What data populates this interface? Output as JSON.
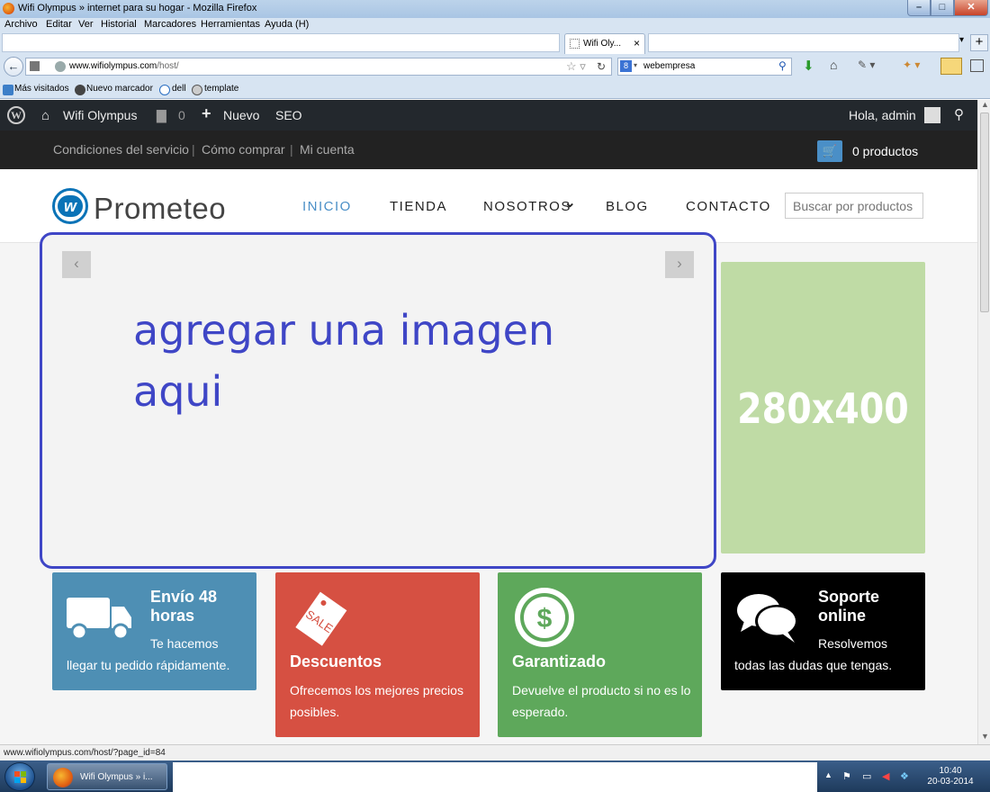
{
  "window": {
    "title": "Wifi Olympus » internet para su hogar - Mozilla Firefox",
    "minimize": "–",
    "maximize": "□",
    "close": "✕"
  },
  "menu": [
    "Archivo",
    "Editar",
    "Ver",
    "Historial",
    "Marcadores",
    "Herramientas",
    "Ayuda (H)"
  ],
  "tabs": {
    "active_label": "Wifi Oly...",
    "close": "×",
    "dropdown": "▾",
    "new_tab": "+"
  },
  "navigation": {
    "back": "←",
    "url_host": "www.wifiolympus.com",
    "url_path": "/host/",
    "search_engine_icon": "google-icon",
    "search_value": "webempresa"
  },
  "bookmarks": [
    "Más visitados",
    "Nuevo marcador",
    "dell",
    "template"
  ],
  "wp_admin_bar": {
    "site_name": "Wifi Olympus",
    "comments_count": "0",
    "new_label": "Nuevo",
    "seo_label": "SEO",
    "greeting": "Hola, admin"
  },
  "shop_bar": {
    "links": [
      "Condiciones del servicio",
      "Cómo comprar",
      "Mi cuenta"
    ],
    "separator": "|",
    "cart_count": "0 productos"
  },
  "header": {
    "logo_text": "Prometeo",
    "nav": [
      "INICIO",
      "TIENDA",
      "NOSOTROS",
      "BLOG",
      "CONTACTO"
    ],
    "nav_dropdown_caret": "⌄",
    "search_placeholder": "Buscar por productos"
  },
  "slider": {
    "prev": "‹",
    "next": "›",
    "text": "agregar una imagen aqui"
  },
  "side_banner": {
    "text": "280x400"
  },
  "features": [
    {
      "title": "Envío 48 horas",
      "desc_line1": "Te hacemos",
      "desc_line2": "llegar tu pedido rápidamente.",
      "color": "#4e8fb4",
      "icon": "truck-icon"
    },
    {
      "title": "Descuentos",
      "desc": "Ofrecemos los mejores precios posibles.",
      "color": "#d65042",
      "icon": "sale-tag-icon",
      "tag_text": "SALE"
    },
    {
      "title": "Garantizado",
      "desc": "Devuelve el producto si no es lo esperado.",
      "color": "#5ea85b",
      "icon": "dollar-coin-icon",
      "coin_symbol": "$"
    },
    {
      "title": "Soporte online",
      "desc_line1": "Resolvemos",
      "desc_line2": "todas las dudas que tengas.",
      "color": "#000000",
      "icon": "chat-bubbles-icon"
    }
  ],
  "status_url": "www.wifiolympus.com/host/?page_id=84",
  "taskbar": {
    "firefox_label": "Wifi Olympus » i...",
    "time": "10:40",
    "date": "20-03-2014"
  },
  "colors": {
    "accent_blue": "#4a8fc7",
    "slider_border": "#3f46c6",
    "wp_bar": "#23282d"
  }
}
